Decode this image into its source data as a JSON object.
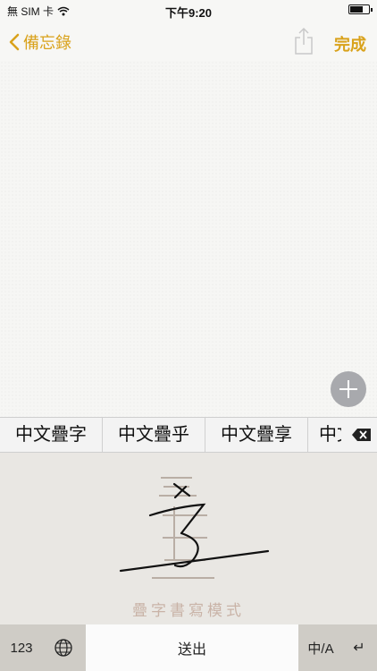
{
  "status_bar": {
    "carrier": "無 SIM 卡",
    "time": "下午9:20"
  },
  "nav_bar": {
    "back_label": "備忘錄",
    "done_label": "完成"
  },
  "candidates": [
    "中文疊字",
    "中文疊乎",
    "中文疊享",
    "中文"
  ],
  "handwriting": {
    "mode_label": "疊字書寫模式"
  },
  "keyboard": {
    "numbers_label": "123",
    "send_label": "送出",
    "lang_label": "中/A",
    "return_label": "↵"
  },
  "colors": {
    "accent": "#d9a21b",
    "pad_background": "#e9e7e3",
    "keyboard_row": "#cfccc6"
  }
}
